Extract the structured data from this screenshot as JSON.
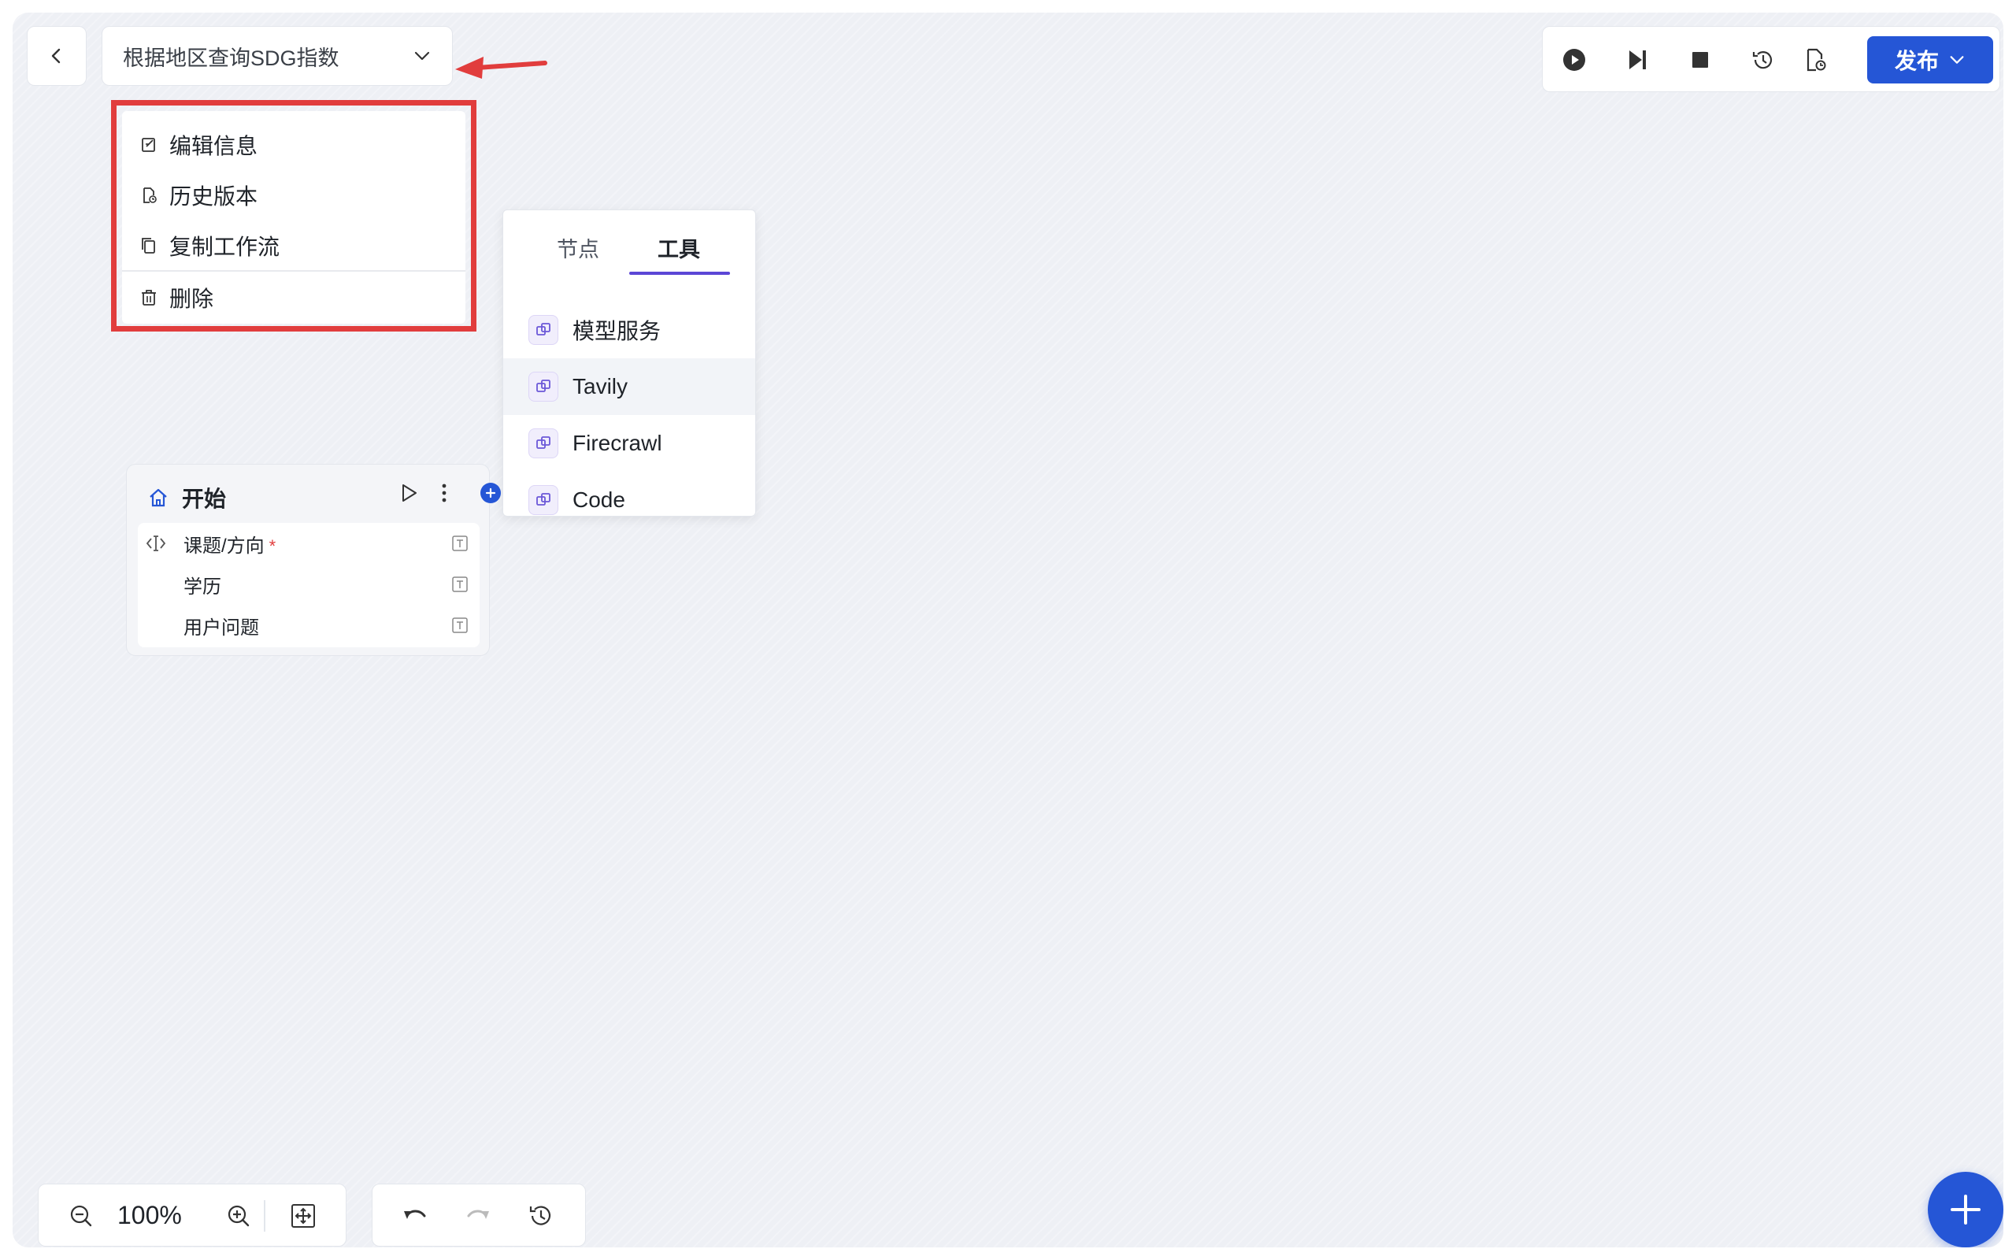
{
  "header": {
    "back_icon": "chevron-left-icon",
    "title": "根据地区查询SDG指数",
    "title_chevron_icon": "chevron-down-icon"
  },
  "dropdown_menu": {
    "items": [
      {
        "icon": "edit-icon",
        "label": "编辑信息"
      },
      {
        "icon": "history-doc-icon",
        "label": "历史版本"
      },
      {
        "icon": "copy-icon",
        "label": "复制工作流"
      },
      {
        "icon": "trash-icon",
        "label": "删除"
      }
    ],
    "highlight_color": "#e13d3d"
  },
  "toolbar": {
    "icons": [
      "play-circle-icon",
      "step-forward-icon",
      "stop-icon",
      "history-icon",
      "document-clock-icon"
    ],
    "publish_label": "发布",
    "publish_color": "#2556d6"
  },
  "panel": {
    "tabs": [
      {
        "label": "节点",
        "active": false
      },
      {
        "label": "工具",
        "active": true
      }
    ],
    "tools": [
      {
        "label": "模型服务",
        "icon": "tool-icon"
      },
      {
        "label": "Tavily",
        "icon": "tool-icon",
        "hovered": true
      },
      {
        "label": "Firecrawl",
        "icon": "tool-icon"
      },
      {
        "label": "Code",
        "icon": "tool-icon"
      }
    ],
    "accent_color": "#5b46d6"
  },
  "start_node": {
    "title": "开始",
    "icon": "home-icon",
    "actions": [
      "run-icon",
      "more-vertical-icon"
    ],
    "params": [
      {
        "label": "课题/方向",
        "required": "*",
        "icon": "text-cursor-icon",
        "type_icon": "text-type-icon"
      },
      {
        "label": "学历",
        "type_icon": "text-type-icon"
      },
      {
        "label": "用户问题",
        "type_icon": "text-type-icon"
      }
    ]
  },
  "bottom_controls": {
    "zoom_level": "100%",
    "zoom_icons": [
      "zoom-out-icon",
      "zoom-in-icon",
      "fit-view-icon"
    ],
    "history_icons": [
      "undo-icon",
      "redo-icon",
      "history-icon"
    ]
  },
  "fab_icon": "plus-icon"
}
